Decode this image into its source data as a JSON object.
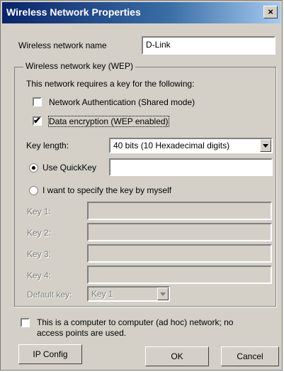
{
  "window": {
    "title": "Wireless Network Properties",
    "close_glyph": "×"
  },
  "network_name": {
    "label": "Wireless network name",
    "value": "D-Link"
  },
  "wep_group": {
    "title": "Wireless network key (WEP)",
    "intro": "This network requires a key for the following:",
    "network_auth_label": "Network Authentication (Shared mode)",
    "network_auth_checked": false,
    "data_encryption_label": "Data encryption (WEP enabled)",
    "data_encryption_checked": true,
    "key_length_label": "Key length:",
    "key_length_value": "40 bits (10 Hexadecimal digits)",
    "use_quickkey_label": "Use QuickKey",
    "use_quickkey_selected": true,
    "quickkey_value": "",
    "specify_key_label": "I want to specify the key by myself",
    "specify_key_selected": false,
    "keys": [
      {
        "label": "Key 1:",
        "value": ""
      },
      {
        "label": "Key 2:",
        "value": ""
      },
      {
        "label": "Key 3:",
        "value": ""
      },
      {
        "label": "Key 4:",
        "value": ""
      }
    ],
    "default_key_label": "Default key:",
    "default_key_value": "Key 1"
  },
  "adhoc": {
    "label_line1": "This is a computer to computer (ad hoc) network; no",
    "label_line2": "access points are used.",
    "checked": false
  },
  "buttons": {
    "ip_config": "IP Config",
    "ok": "OK",
    "cancel": "Cancel"
  },
  "check_glyph": "✔",
  "colors": {
    "title_bar": "#0a246a",
    "dialog_bg": "#d4d0c8",
    "disabled_text": "#808080"
  }
}
